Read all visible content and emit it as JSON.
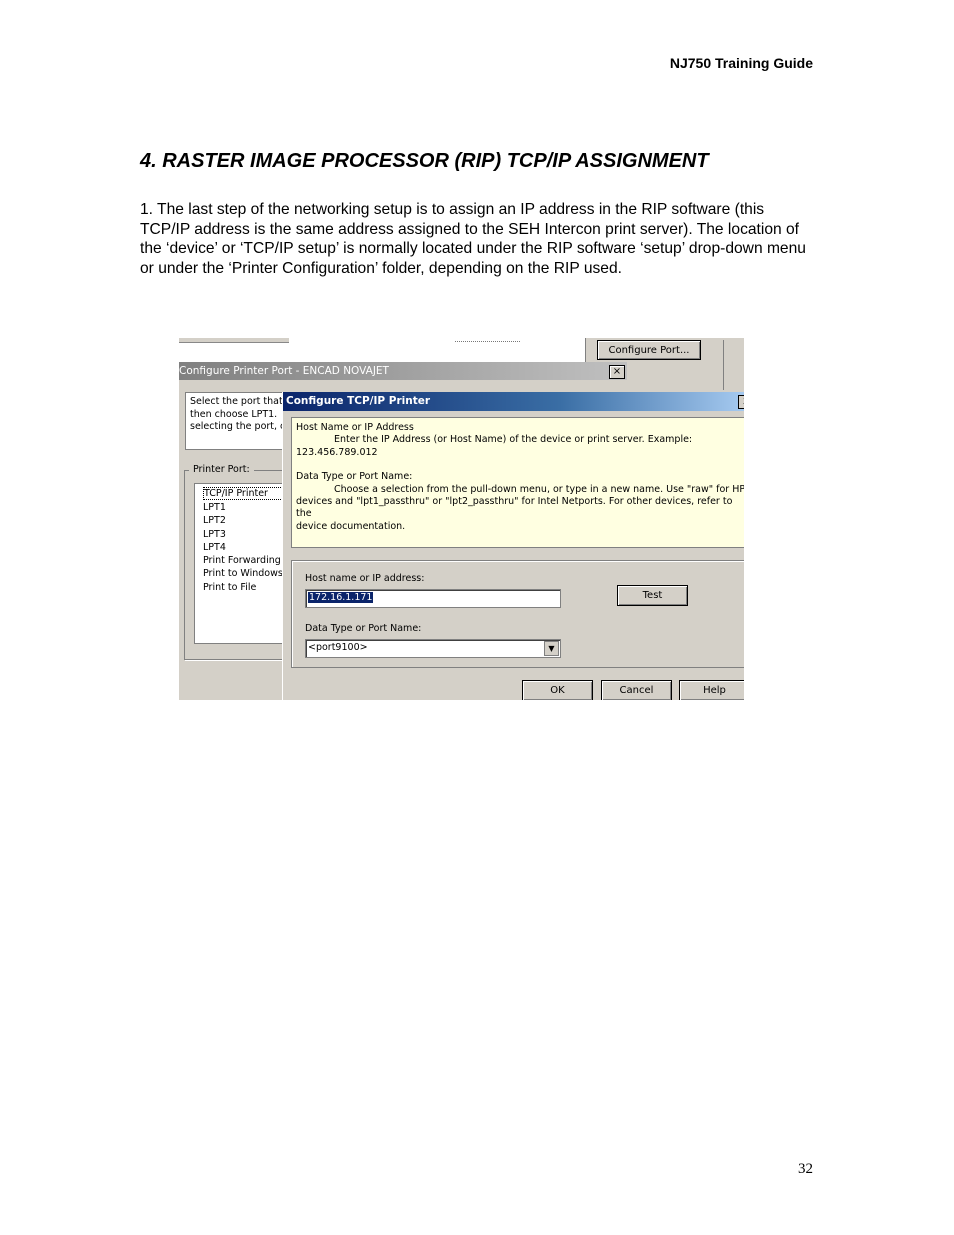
{
  "header": {
    "guide_title": "NJ750 Training Guide"
  },
  "section": {
    "title": "4. RASTER IMAGE PROCESSOR (RIP)  TCP/IP ASSIGNMENT"
  },
  "body": {
    "paragraph": "1. The last step of the networking setup is to assign an IP address in the RIP software (this TCP/IP address is the same address assigned to the SEH Intercon print server). The location of the ‘device’ or ‘TCP/IP setup’ is normally located under the RIP software ‘setup’ drop-down menu or under the ‘Printer Configuration’ folder, depending on the RIP used."
  },
  "screenshot": {
    "top_button": "Configure Port...",
    "back_dialog": {
      "title": "Configure Printer Port - ENCAD NOVAJET",
      "close": "×",
      "desc_lines": [
        "Select the port that t",
        "then choose LPT1.",
        "selecting the port, cl"
      ],
      "group_label": "Printer Port:",
      "ports": [
        "TCP/IP Printer",
        "LPT1",
        "LPT2",
        "LPT3",
        "LPT4",
        "Print Forwarding",
        "Print to Windows",
        "Print to File"
      ]
    },
    "front_dialog": {
      "title": "Configure TCP/IP Printer",
      "close": "x",
      "info": {
        "host_heading": "Host Name or IP Address",
        "host_text": "Enter the IP Address (or Host Name) of the device or print server.  Example:",
        "host_example": "123.456.789.012",
        "type_heading": "Data Type or Port Name:",
        "type_text_1": "Choose a selection from the pull-down menu, or type in a new name.  Use \"raw\" for HP",
        "type_text_2": "devices and \"lpt1_passthru\" or \"lpt2_passthru\" for Intel Netports.  For other devices, refer to the",
        "type_text_3": "device documentation."
      },
      "host_label": "Host name or IP address:",
      "host_value": "172.16.1.171",
      "test_button": "Test",
      "port_label": "Data Type or Port Name:",
      "port_value": "<port9100>",
      "ok_button": "OK",
      "cancel_button": "Cancel",
      "help_button": "Help"
    }
  },
  "footer": {
    "page_number": "32"
  }
}
